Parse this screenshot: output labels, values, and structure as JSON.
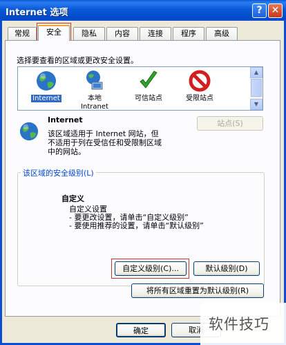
{
  "window": {
    "title": "Internet 选项",
    "help_label": "?",
    "close_label": "✕"
  },
  "tabs": [
    {
      "label": "常规"
    },
    {
      "label": "安全"
    },
    {
      "label": "隐私"
    },
    {
      "label": "内容"
    },
    {
      "label": "连接"
    },
    {
      "label": "程序"
    },
    {
      "label": "高级"
    }
  ],
  "security": {
    "zone_prompt": "选择要查看的区域或更改安全设置。",
    "zones": [
      {
        "name": "Internet",
        "icon": "globe-icon"
      },
      {
        "name": "本地\nIntranet",
        "icon": "local-intranet-icon"
      },
      {
        "name": "可信站点",
        "icon": "check-icon"
      },
      {
        "name": "受限站点",
        "icon": "restricted-icon"
      }
    ],
    "selected_zone": "Internet",
    "zone_title": "Internet",
    "zone_description_1": "该区域适用于 Internet 网站，但",
    "zone_description_2": "不适用于列在受信任和受限制区域",
    "zone_description_3": "中的网站。",
    "sites_button": "站点(S)",
    "level_group_title": "该区域的安全级别(L)",
    "level_name": "自定义",
    "level_line_1": "自定义设置",
    "level_line_2": "- 要更改设置，请单击“自定义级别”",
    "level_line_3": "- 要使用推荐的设置，请单击“默认级别”",
    "custom_level_button": "自定义级别(C)...",
    "default_level_button": "默认级别(D)",
    "reset_all_button": "将所有区域重置为默认级别(R)"
  },
  "footer": {
    "ok_button": "确定",
    "cancel_button": "取消"
  },
  "watermark": "软件技巧"
}
